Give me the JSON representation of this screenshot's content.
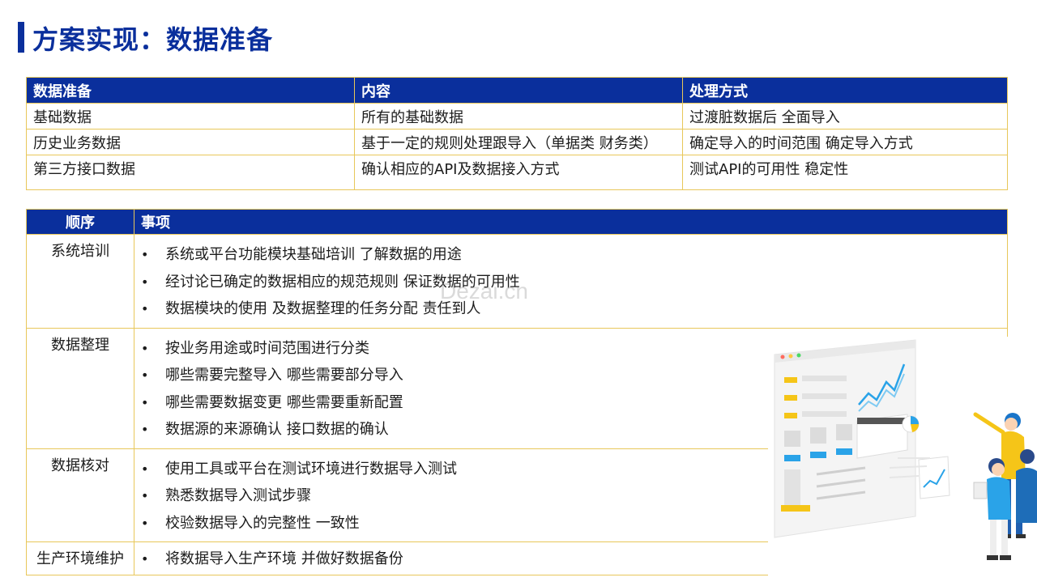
{
  "title": "方案实现：数据准备",
  "watermark": "Dezai.cn",
  "table1": {
    "headers": [
      "数据准备",
      "内容",
      "处理方式"
    ],
    "rows": [
      [
        "基础数据",
        "所有的基础数据",
        "过渡脏数据后 全面导入"
      ],
      [
        "历史业务数据",
        "基于一定的规则处理跟导入（单据类 财务类）",
        "确定导入的时间范围 确定导入方式"
      ],
      [
        "第三方接口数据",
        "确认相应的API及数据接入方式",
        "测试API的可用性 稳定性"
      ]
    ]
  },
  "table2": {
    "headers": [
      "顺序",
      "事项"
    ],
    "rows": [
      {
        "step": "系统培训",
        "items": [
          "系统或平台功能模块基础培训 了解数据的用途",
          "经讨论已确定的数据相应的规范规则 保证数据的可用性",
          "数据模块的使用 及数据整理的任务分配 责任到人"
        ]
      },
      {
        "step": "数据整理",
        "items": [
          "按业务用途或时间范围进行分类",
          "哪些需要完整导入 哪些需要部分导入",
          "哪些需要数据变更 哪些需要重新配置",
          "数据源的来源确认 接口数据的确认"
        ]
      },
      {
        "step": "数据核对",
        "items": [
          "使用工具或平台在测试环境进行数据导入测试",
          "熟悉数据导入测试步骤",
          "校验数据导入的完整性 一致性"
        ]
      },
      {
        "step": "生产环境维护",
        "items": [
          "将数据导入生产环境 并做好数据备份"
        ]
      }
    ]
  },
  "colors": {
    "primary": "#0a2f9c",
    "border": "#e8c75a",
    "accent_yellow": "#f5c518",
    "accent_blue": "#2aa3e8"
  },
  "illustration": {
    "icon": "data-dashboard-people-illustration"
  }
}
